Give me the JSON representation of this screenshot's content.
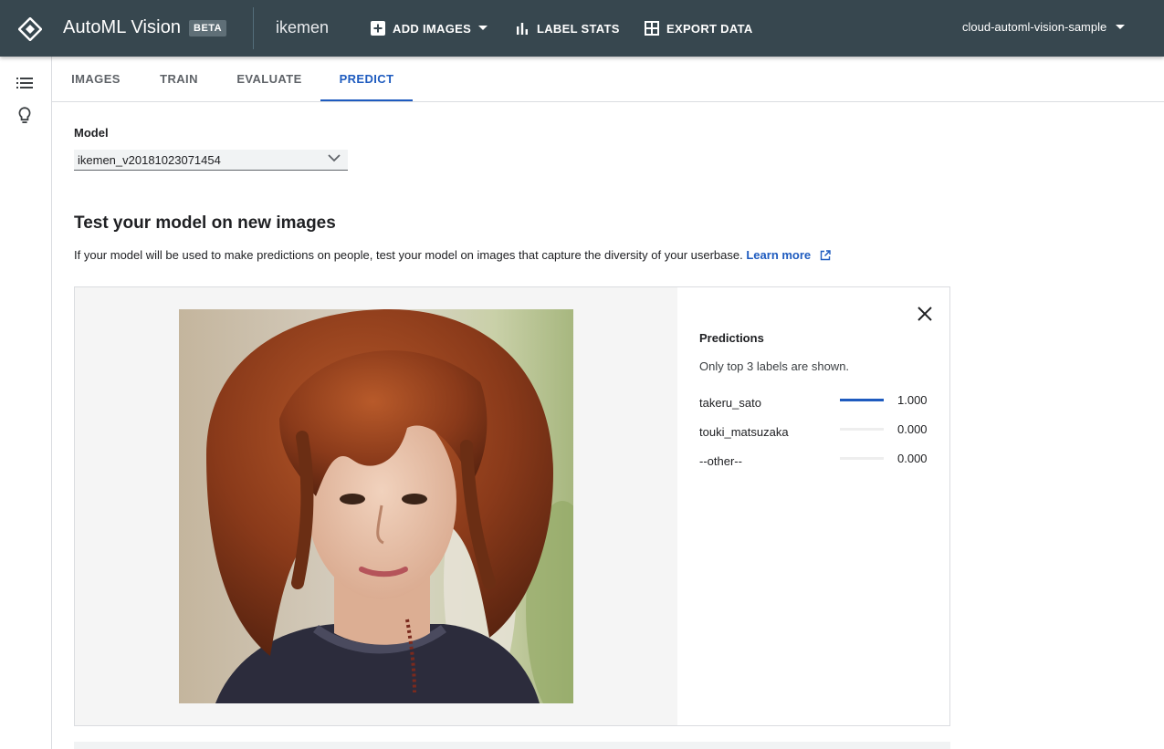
{
  "header": {
    "app_title": "AutoML Vision",
    "badge": "BETA",
    "dataset": "ikemen",
    "add_images": "ADD IMAGES",
    "label_stats": "LABEL STATS",
    "export_data": "EXPORT DATA",
    "project": "cloud-automl-vision-sample"
  },
  "rail": {
    "icons": [
      "list-icon",
      "lightbulb-icon"
    ]
  },
  "tabs": [
    "IMAGES",
    "TRAIN",
    "EVALUATE",
    "PREDICT"
  ],
  "active_tab": "PREDICT",
  "model": {
    "label": "Model",
    "selected": "ikemen_v20181023071454"
  },
  "test": {
    "title": "Test your model on new images",
    "description": "If your model will be used to make predictions on people, test your model on images that capture the diversity of your userbase.",
    "learn_more": "Learn more"
  },
  "predictions": {
    "title": "Predictions",
    "note": "Only top 3 labels are shown.",
    "items": [
      {
        "label": "takeru_sato",
        "score_text": "1.000",
        "score": 1.0
      },
      {
        "label": "touki_matsuzaka",
        "score_text": "0.000",
        "score": 0.0
      },
      {
        "label": "--other--",
        "score_text": "0.000",
        "score": 0.0
      }
    ]
  },
  "colors": {
    "header_bg": "#37474f",
    "accent": "#1e5bbf",
    "image_pane_bg": "#f5f5f5"
  }
}
